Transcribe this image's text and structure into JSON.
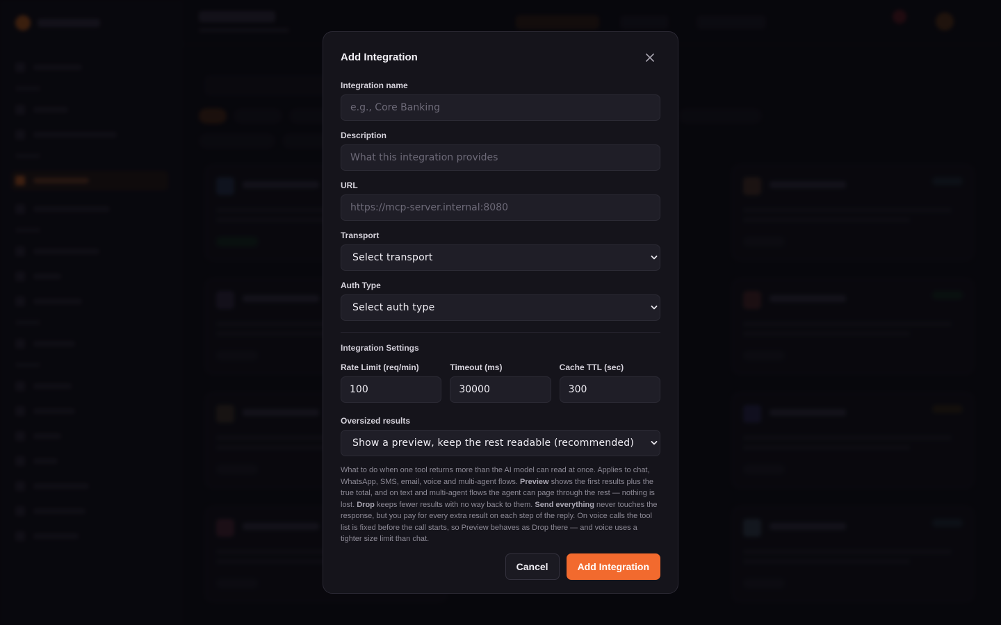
{
  "modal": {
    "title": "Add Integration",
    "fields": {
      "name": {
        "label": "Integration name",
        "placeholder": "e.g., Core Banking"
      },
      "description": {
        "label": "Description",
        "placeholder": "What this integration provides"
      },
      "url": {
        "label": "URL",
        "placeholder": "https://mcp-server.internal:8080"
      },
      "transport": {
        "label": "Transport",
        "value": "Select transport"
      },
      "auth_type": {
        "label": "Auth Type",
        "value": "Select auth type"
      }
    },
    "settings": {
      "title": "Integration Settings",
      "rate_limit": {
        "label": "Rate Limit (req/min)",
        "value": "100"
      },
      "timeout": {
        "label": "Timeout (ms)",
        "value": "30000"
      },
      "cache_ttl": {
        "label": "Cache TTL (sec)",
        "value": "300"
      }
    },
    "oversized": {
      "label": "Oversized results",
      "value": "Show a preview, keep the rest readable (recommended)",
      "help": {
        "p1": "What to do when one tool returns more than the AI model can read at once. Applies to chat, WhatsApp, SMS, email, voice and multi-agent flows. ",
        "b1": "Preview",
        "p2": " shows the first results plus the true total, and on text and multi-agent flows the agent can page through the rest — nothing is lost. ",
        "b2": "Drop",
        "p3": " keeps fewer results with no way back to them. ",
        "b3": "Send everything",
        "p4": " never touches the response, but you pay for every extra result on each step of the reply. On voice calls the tool list is fixed before the call starts, so Preview behaves as Drop there — and voice uses a tighter size limit than chat."
      }
    },
    "buttons": {
      "cancel": "Cancel",
      "submit": "Add Integration"
    }
  },
  "icons": {
    "close": "close-icon",
    "chevron": "chevron-down-icon"
  },
  "colors": {
    "accent": "#f26a2e",
    "modal_bg": "#15141b",
    "input_bg": "#1f1e27"
  }
}
